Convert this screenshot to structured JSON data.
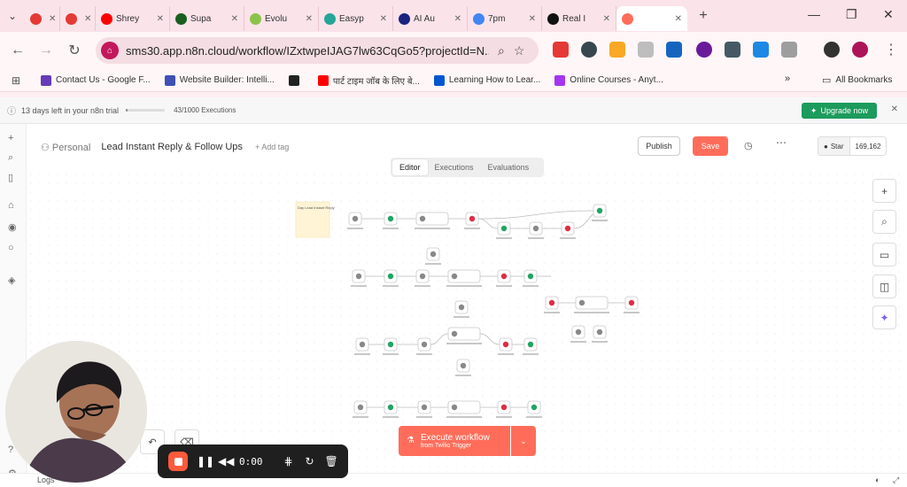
{
  "browser": {
    "tabs": [
      {
        "label": "",
        "color": "#e53935"
      },
      {
        "label": "",
        "color": "#e53935"
      },
      {
        "label": "Shrey",
        "color": "#ff0000"
      },
      {
        "label": "Supa",
        "color": "#1b5e20"
      },
      {
        "label": "Evolu",
        "color": "#8bc34a"
      },
      {
        "label": "Easyp",
        "color": "#26a69a"
      },
      {
        "label": "AI Au",
        "color": "#1a237e"
      },
      {
        "label": "7pm",
        "color": "#4285f4"
      },
      {
        "label": "Real I",
        "color": "#111111"
      },
      {
        "label": "",
        "color": "#ff6d5a"
      }
    ],
    "url": "sms30.app.n8n.cloud/workflow/IZxtwpeIJAG7lw63CqGo5?projectId=N...",
    "bookmarks": [
      {
        "label": "Contact Us - Google F...",
        "color": "#673ab7"
      },
      {
        "label": "Website Builder: Intelli...",
        "color": "#3f51b5"
      },
      {
        "label": "",
        "color": "#222222"
      },
      {
        "label": "पार्ट टाइम जॉब के लिए बे...",
        "color": "#ff0000"
      },
      {
        "label": "Learning How to Lear...",
        "color": "#0056d2"
      },
      {
        "label": "Online Courses - Anyt...",
        "color": "#a435f0"
      }
    ],
    "all_bookmarks": "All Bookmarks"
  },
  "trial": {
    "text": "13 days left in your n8n trial",
    "executions": "43/1000 Executions",
    "progress": 0.043,
    "upgrade_label": "Upgrade now"
  },
  "header": {
    "project": "Personal",
    "title": "Lead Instant Reply & Follow Ups",
    "add_tag": "+ Add tag",
    "publish_label": "Publish",
    "save_label": "Save",
    "star_label": "Star",
    "star_count": "169,162"
  },
  "view_tabs": [
    "Editor",
    "Executions",
    "Evaluations"
  ],
  "sticky_note": "Day Lead Instant Reply",
  "execute": {
    "main": "Execute workflow",
    "sub": "from Twilio Trigger"
  },
  "status": {
    "logs": "Logs"
  },
  "recorder": {
    "time": "0:00"
  },
  "colors": {
    "accent": "#ff6d5a",
    "upgrade": "#1c9b5c",
    "sheets": "#21a464",
    "twilio": "#e02c43"
  }
}
